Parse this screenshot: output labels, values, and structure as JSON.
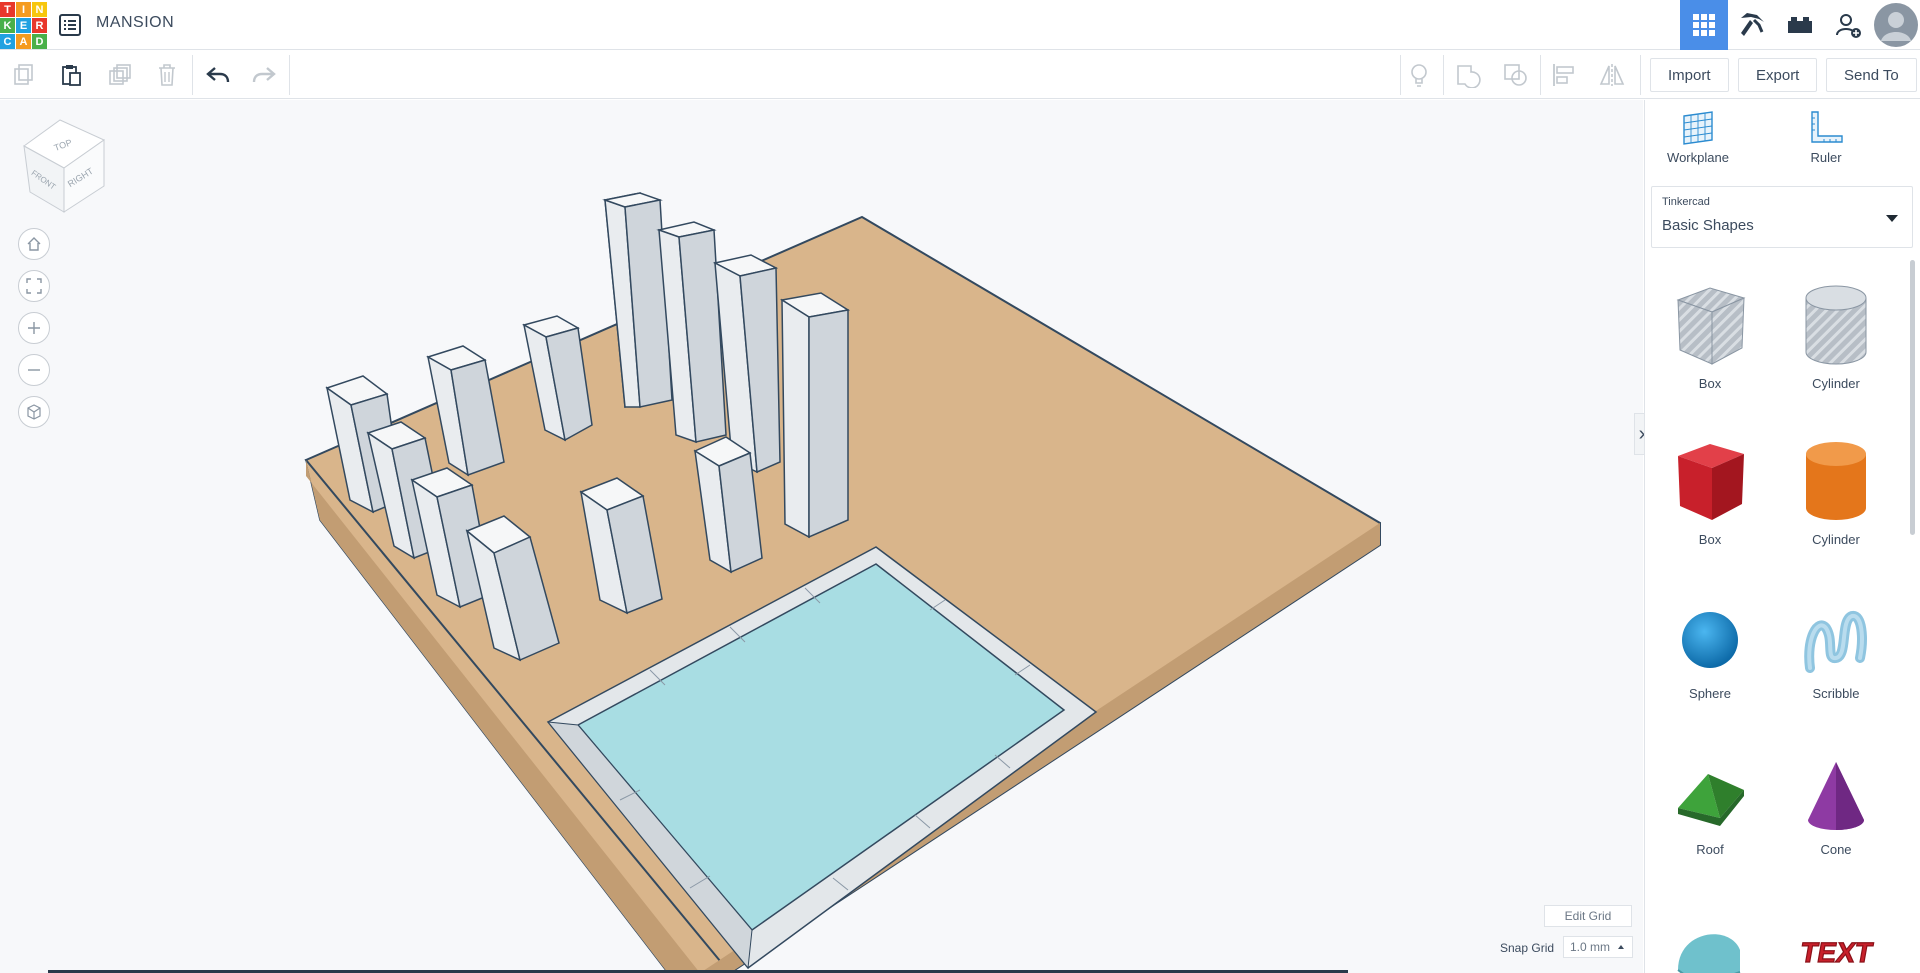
{
  "app": {
    "logo_letters": [
      "T",
      "I",
      "N",
      "K",
      "E",
      "R",
      "C",
      "A",
      "D"
    ],
    "logo_colors": [
      "#e8372b",
      "#f59b1f",
      "#f7c60d",
      "#49b04a",
      "#21a1e1",
      "#e8372b",
      "#21a1e1",
      "#f59b1f",
      "#49b04a"
    ],
    "title": "MANSION"
  },
  "header": {
    "views": [
      {
        "name": "3d-design-view",
        "icon": "grid-icon",
        "active": true
      },
      {
        "name": "minecraft-view",
        "icon": "pickaxe-icon",
        "active": false
      },
      {
        "name": "lego-view",
        "icon": "brick-icon",
        "active": false
      },
      {
        "name": "invite-view",
        "icon": "add-user-icon",
        "active": false
      },
      {
        "name": "profile",
        "icon": "avatar-icon",
        "active": false
      }
    ]
  },
  "toolbar": {
    "import_label": "Import",
    "export_label": "Export",
    "sendto_label": "Send To"
  },
  "viewcube": {
    "top": "TOP",
    "front": "FRONT",
    "right": "RIGHT"
  },
  "canvas": {
    "edit_grid_label": "Edit Grid",
    "snap_grid_label": "Snap Grid",
    "snap_grid_value": "1.0 mm"
  },
  "panel": {
    "workplane_label": "Workplane",
    "ruler_label": "Ruler",
    "library_provider": "Tinkercad",
    "library_name": "Basic Shapes",
    "shapes": [
      {
        "label": "Box",
        "icon": "box-hole-icon"
      },
      {
        "label": "Cylinder",
        "icon": "cylinder-hole-icon"
      },
      {
        "label": "Box",
        "icon": "box-icon"
      },
      {
        "label": "Cylinder",
        "icon": "cylinder-icon"
      },
      {
        "label": "Sphere",
        "icon": "sphere-icon"
      },
      {
        "label": "Scribble",
        "icon": "scribble-icon"
      },
      {
        "label": "Roof",
        "icon": "roof-icon"
      },
      {
        "label": "Cone",
        "icon": "cone-icon"
      },
      {
        "label": "",
        "icon": "round-roof-icon"
      },
      {
        "label": "",
        "icon": "text-icon"
      }
    ],
    "text_shape_text": "TEXT"
  },
  "colors": {
    "accent": "#4a8ee8",
    "workplane": "#d9b58b",
    "workplane_side": "#c29d73",
    "pillar": "#e9ecef",
    "water": "#a8dde3",
    "box_red": "#c8202b",
    "cylinder_orange": "#e4761b",
    "sphere_blue": "#1c8fd6",
    "roof_green": "#3ea33b",
    "cone_purple": "#8e3aa3"
  }
}
